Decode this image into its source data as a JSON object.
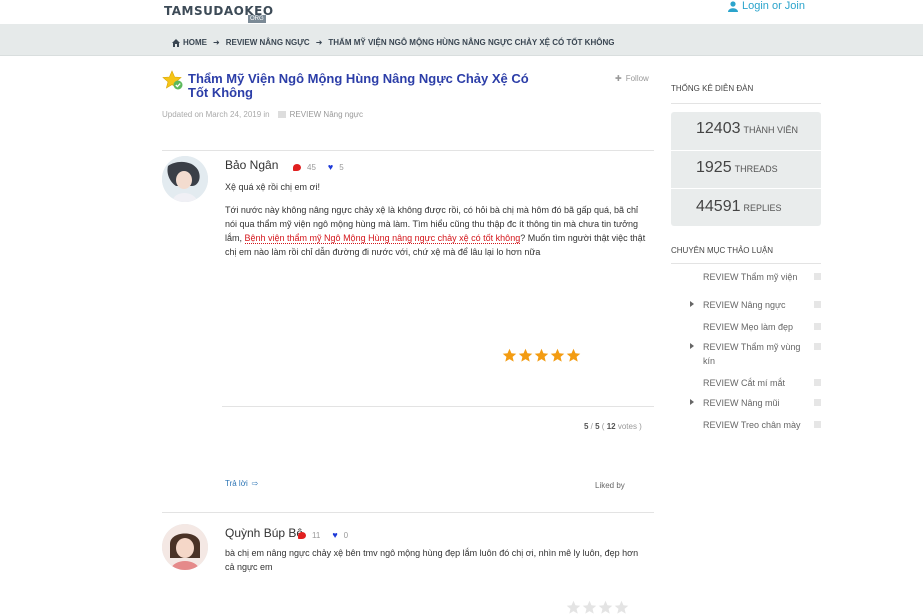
{
  "header": {
    "logo": "TAMSUDAOKEO",
    "logo_sub": "ORG",
    "login_label": "Login or Join"
  },
  "breadcrumb": {
    "home": "HOME",
    "section": "REVIEW NÂNG NGỰC",
    "current": "THẨM MỸ VIỆN NGÔ MỘNG HÙNG NÂNG NGỰC CHẢY XỆ CÓ TỐT KHÔNG"
  },
  "thread": {
    "title": "Thẩm Mỹ Viện Ngô Mộng Hùng Nâng Ngực Chảy Xệ Có Tốt Không",
    "follow_label": "Follow",
    "updated": "Updated on March 24, 2019 in",
    "category": "REVIEW Nâng ngực"
  },
  "posts": [
    {
      "author": "Bảo Ngân",
      "comments": "45",
      "likes": "5",
      "line1": "Xệ quá xệ rồi chị em ơi!",
      "p_before": "Tới nước này không nâng ngực chảy xệ là không được rồi, có hỏi bà chị mà hôm đó bã gấp quá, bã chỉ nói qua thẩm mỹ viện ngô mộng hùng mà làm. Tìm hiểu cũng thu thập đc ít thông tin mà chưa tin tưởng lắm, ",
      "link": "Bệnh viện thẩm mỹ Ngô Mộng Hùng nâng ngực chảy xệ có tốt không",
      "p_after": "? Muốn tìm người thật việc thật chị em nào làm rồi chỉ dẫn đường đi nước với, chứ xệ mà để lâu lại lo hơn nữa",
      "rating_value": "5",
      "rating_max": "5",
      "votes": "12",
      "votes_label": "votes",
      "reply_label": "Trả lời",
      "liked_by": "Liked by"
    },
    {
      "author": "Quỳnh Búp Bê",
      "comments": "11",
      "likes": "0",
      "line1": "bà chị em nâng ngực chảy xệ bên tmv ngô mộng hùng đẹp lắm luôn đó chị ơi, nhìn mê ly luôn, đẹp hơn cả ngực em"
    }
  ],
  "sidebar": {
    "stats_heading": "THỐNG KÊ DIỄN ĐÀN",
    "members_value": "12403",
    "members_label": "THÀNH VIÊN",
    "threads_value": "1925",
    "threads_label": "THREADS",
    "replies_value": "44591",
    "replies_label": "REPLIES",
    "categories_heading": "CHUYÊN MỤC THẢO LUẬN",
    "categories": [
      {
        "label": "REVIEW Thẩm mỹ viện",
        "arrow": false
      },
      {
        "label": "REVIEW Nâng ngực",
        "arrow": true
      },
      {
        "label": "REVIEW Mẹo làm đẹp",
        "arrow": false
      },
      {
        "label": "REVIEW Thẩm mỹ vùng kín",
        "arrow": true
      },
      {
        "label": "REVIEW Cắt mí mắt",
        "arrow": false
      },
      {
        "label": "REVIEW Nâng mũi",
        "arrow": true
      },
      {
        "label": "REVIEW Treo chân mày",
        "arrow": false
      }
    ]
  },
  "colors": {
    "title_blue": "#2c3ea8",
    "link_red": "#d4161b",
    "star_orange": "#f39c12",
    "login_blue": "#2ba4cc"
  }
}
